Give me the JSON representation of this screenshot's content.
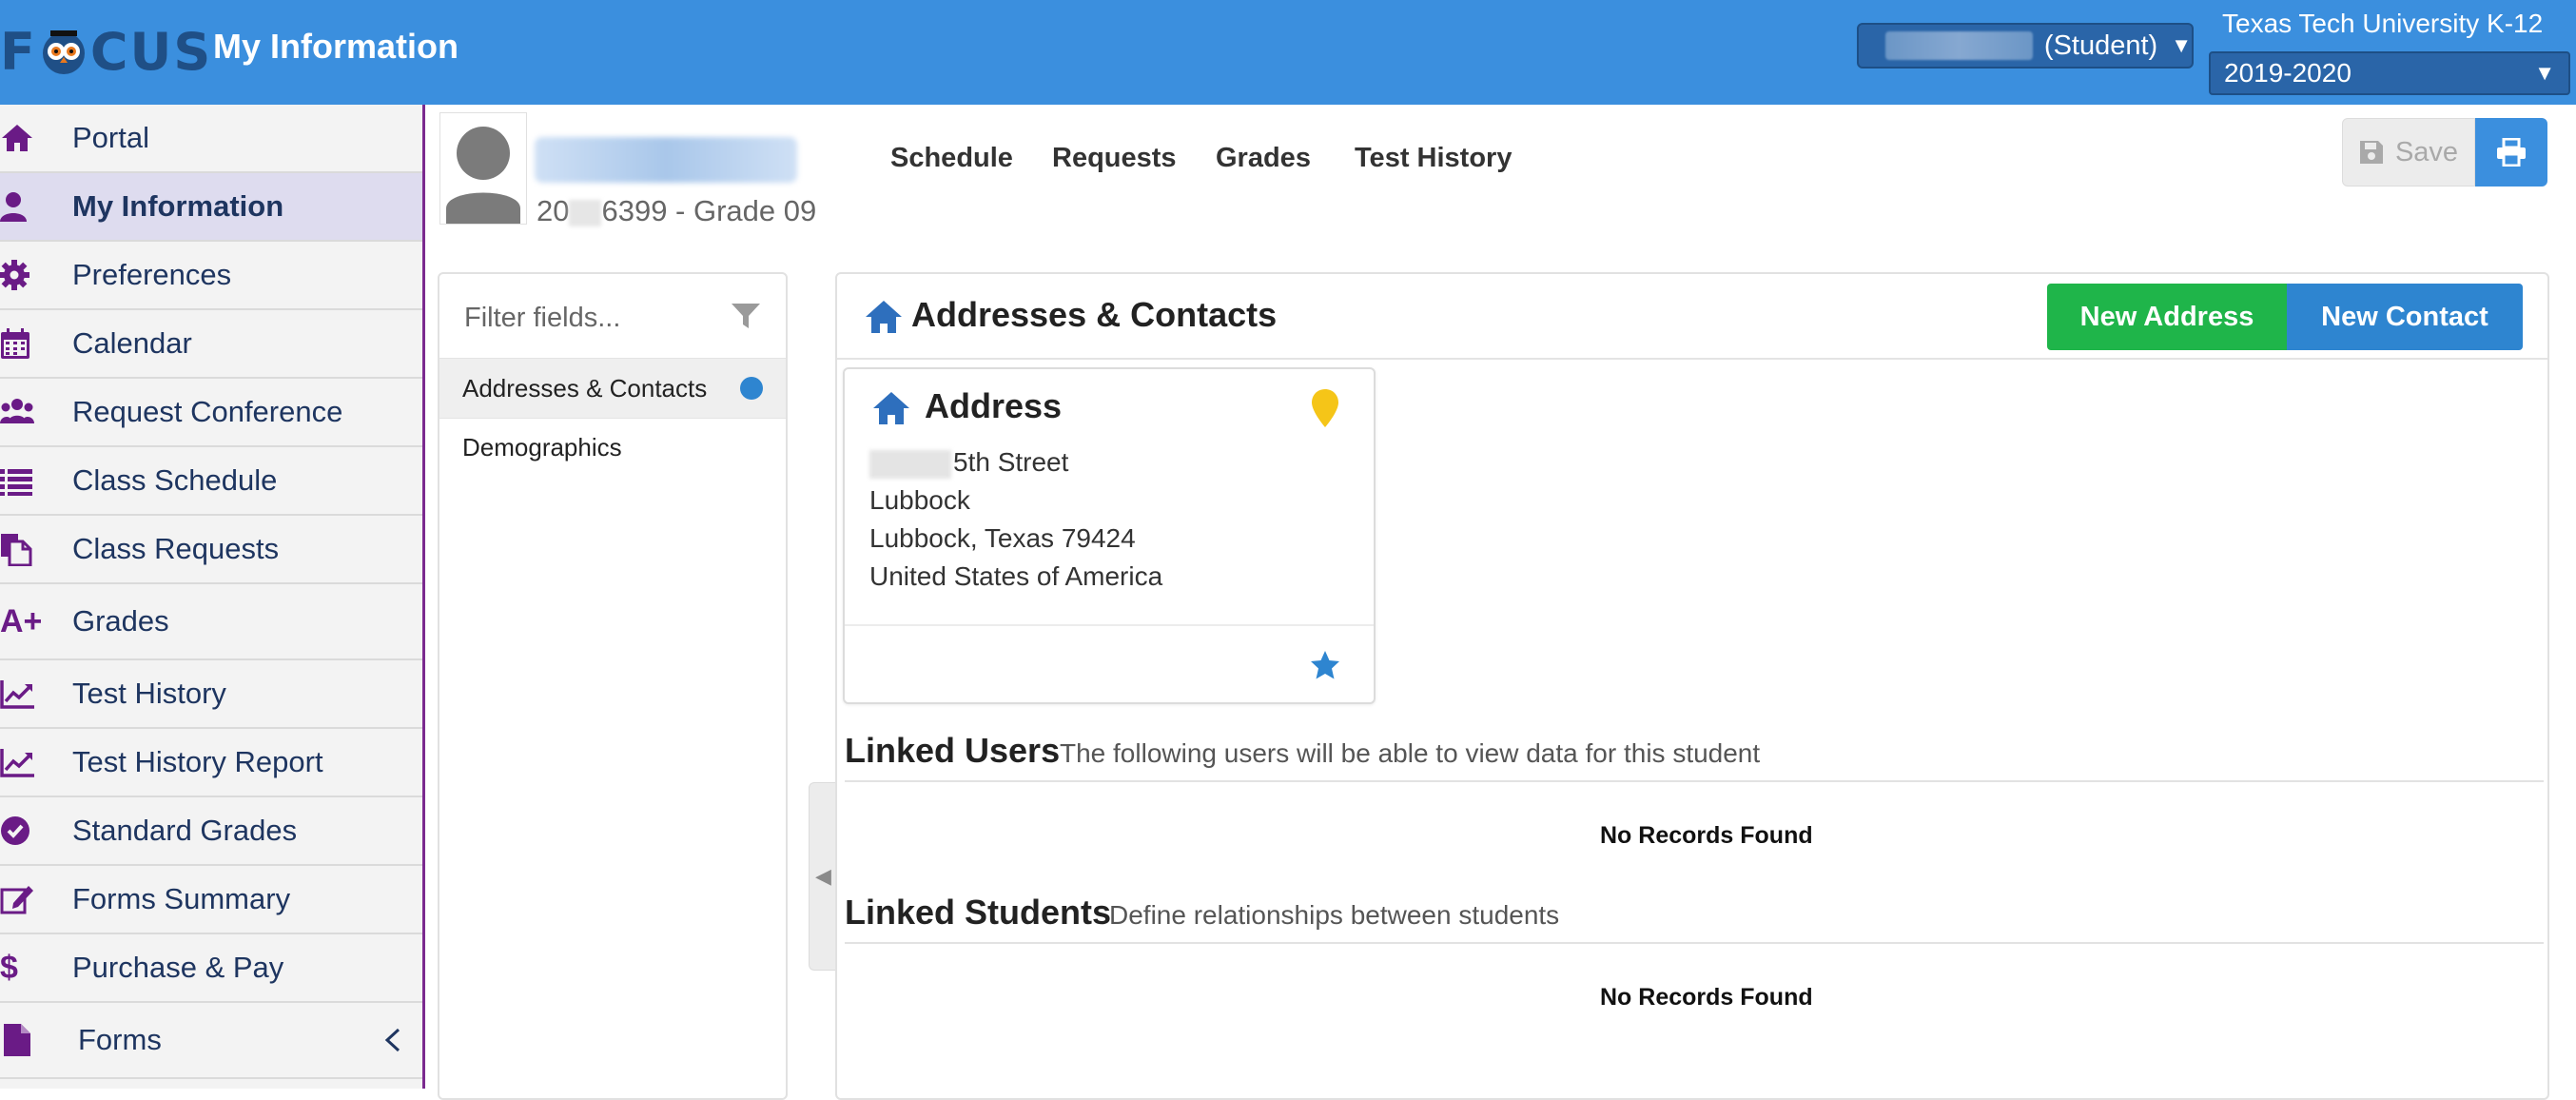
{
  "header": {
    "logo_text_left": "F",
    "logo_text_right": "CUS",
    "page_title": "My Information",
    "student_role": "(Student)",
    "student_select_arrow": "▼",
    "school_name": "Texas Tech University K-12",
    "school_year": "2019-2020",
    "year_arrow": "▼"
  },
  "sidebar": {
    "items": [
      {
        "label": "Portal",
        "icon": "home-icon"
      },
      {
        "label": "My Information",
        "icon": "user-icon",
        "active": true
      },
      {
        "label": "Preferences",
        "icon": "gear-icon"
      },
      {
        "label": "Calendar",
        "icon": "calendar-icon"
      },
      {
        "label": "Request Conference",
        "icon": "users-icon"
      },
      {
        "label": "Class Schedule",
        "icon": "list-icon"
      },
      {
        "label": "Class Requests",
        "icon": "copy-icon"
      },
      {
        "label": "Grades",
        "icon": "a-plus-icon",
        "icon_text": "A+"
      },
      {
        "label": "Test History",
        "icon": "line-chart-icon"
      },
      {
        "label": "Test History Report",
        "icon": "line-chart-icon"
      },
      {
        "label": "Standard Grades",
        "icon": "check-circle-icon"
      },
      {
        "label": "Forms Summary",
        "icon": "edit-icon"
      },
      {
        "label": "Purchase & Pay",
        "icon": "dollar-icon",
        "icon_text": "$"
      },
      {
        "label": "Forms",
        "icon": "file-icon",
        "has_chevron": true
      }
    ]
  },
  "profile": {
    "id_prefix": "20",
    "id_suffix": "6399 - Grade 09"
  },
  "tabs": [
    "Schedule",
    "Requests",
    "Grades",
    "Test History"
  ],
  "toolbar": {
    "save_label": "Save"
  },
  "filter": {
    "placeholder": "Filter fields...",
    "sections": [
      {
        "label": "Addresses & Contacts",
        "active": true
      },
      {
        "label": "Demographics"
      }
    ]
  },
  "panel": {
    "title": "Addresses & Contacts",
    "new_address_label": "New Address",
    "new_contact_label": "New Contact"
  },
  "address_card": {
    "title": "Address",
    "street": "5th Street",
    "city": "Lubbock",
    "city_state_zip": "Lubbock, Texas 79424",
    "country": "United States of America"
  },
  "linked_users": {
    "title": "Linked Users",
    "description": "The following users will be able to view data for this student",
    "empty_text": "No Records Found"
  },
  "linked_students": {
    "title": "Linked Students",
    "description": "Define relationships between students",
    "empty_text": "No Records Found"
  },
  "colors": {
    "header_bg": "#3b8fde",
    "sidebar_icon": "#6a1b86",
    "sidebar_text": "#1e3560",
    "new_address": "#1fb54a",
    "new_contact": "#2e85d0",
    "pin": "#f5c518"
  }
}
